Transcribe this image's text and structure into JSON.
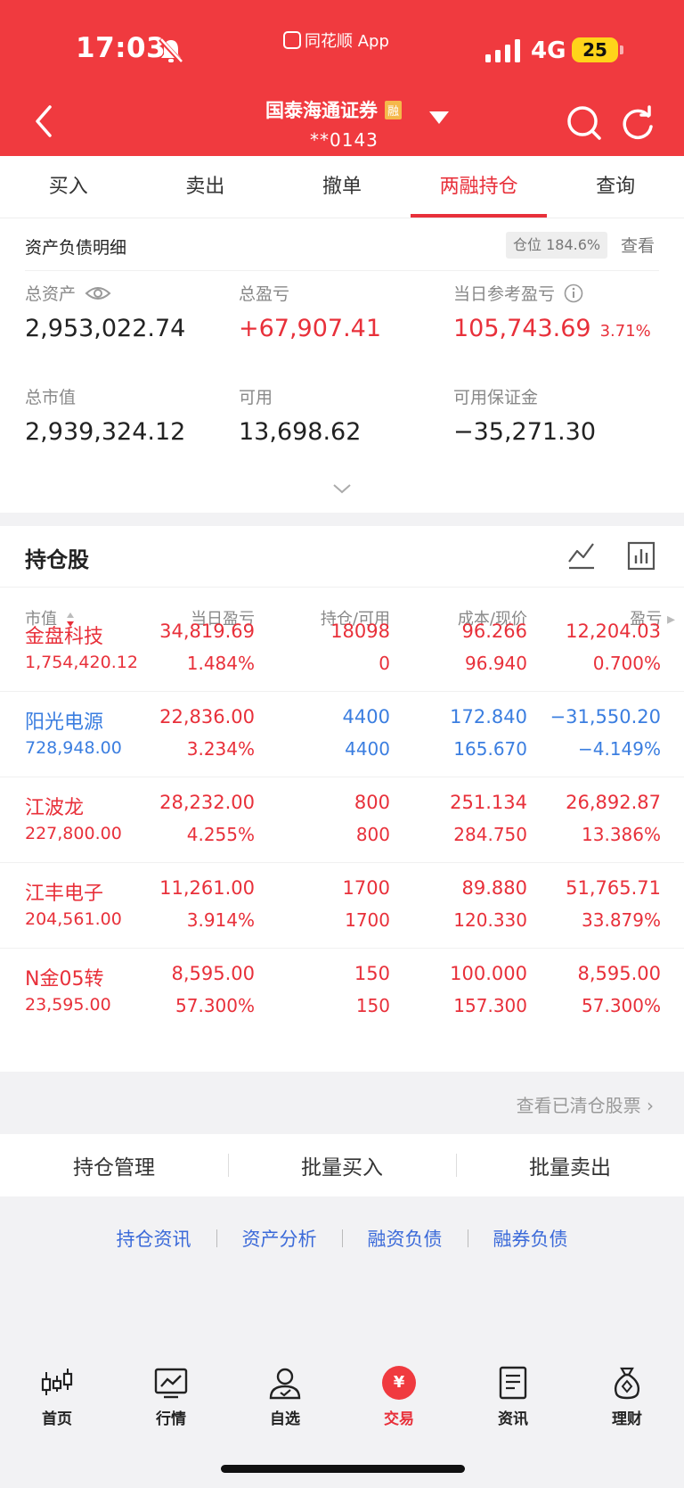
{
  "status_bar": {
    "time": "17:03",
    "app_name": "同花顺 App",
    "network": "4G",
    "battery": "25"
  },
  "header": {
    "broker": "国泰海通证券",
    "badge": "融",
    "account": "**0143"
  },
  "tabs": [
    {
      "label": "买入"
    },
    {
      "label": "卖出"
    },
    {
      "label": "撤单"
    },
    {
      "label": "两融持仓",
      "active": true
    },
    {
      "label": "查询"
    }
  ],
  "assets": {
    "title": "资产负债明细",
    "position_ratio": "仓位 184.6%",
    "view_label": "查看",
    "total_assets": {
      "label": "总资产",
      "value": "2,953,022.74"
    },
    "total_pnl": {
      "label": "总盈亏",
      "value": "+67,907.41"
    },
    "daily_pnl": {
      "label": "当日参考盈亏",
      "value": "105,743.69",
      "pct": "3.71%"
    },
    "market_value": {
      "label": "总市值",
      "value": "2,939,324.12"
    },
    "available": {
      "label": "可用",
      "value": "13,698.62"
    },
    "available_margin": {
      "label": "可用保证金",
      "value": "−35,271.30"
    }
  },
  "holdings": {
    "title": "持仓股",
    "columns": {
      "market_value": "市值",
      "daily_pnl": "当日盈亏",
      "position": "持仓/可用",
      "cost_price": "成本/现价",
      "pnl": "盈亏"
    },
    "rows": [
      {
        "name": "金盘科技",
        "market_value": "1,754,420.12",
        "daily_pnl": "34,819.69",
        "daily_pct": "1.484%",
        "position": "18098",
        "available": "0",
        "cost": "96.266",
        "price": "96.940",
        "pnl": "12,204.03",
        "pnl_pct": "0.700%",
        "color": "red"
      },
      {
        "name": "阳光电源",
        "market_value": "728,948.00",
        "daily_pnl": "22,836.00",
        "daily_pct": "3.234%",
        "position": "4400",
        "available": "4400",
        "cost": "172.840",
        "price": "165.670",
        "pnl": "−31,550.20",
        "pnl_pct": "−4.149%",
        "color": "blue"
      },
      {
        "name": "江波龙",
        "market_value": "227,800.00",
        "daily_pnl": "28,232.00",
        "daily_pct": "4.255%",
        "position": "800",
        "available": "800",
        "cost": "251.134",
        "price": "284.750",
        "pnl": "26,892.87",
        "pnl_pct": "13.386%",
        "color": "red"
      },
      {
        "name": "江丰电子",
        "market_value": "204,561.00",
        "daily_pnl": "11,261.00",
        "daily_pct": "3.914%",
        "position": "1700",
        "available": "1700",
        "cost": "89.880",
        "price": "120.330",
        "pnl": "51,765.71",
        "pnl_pct": "33.879%",
        "color": "red"
      },
      {
        "name": "N金05转",
        "market_value": "23,595.00",
        "daily_pnl": "8,595.00",
        "daily_pct": "57.300%",
        "position": "150",
        "available": "150",
        "cost": "100.000",
        "price": "157.300",
        "pnl": "8,595.00",
        "pnl_pct": "57.300%",
        "color": "red"
      }
    ],
    "cleared_link": "查看已清仓股票"
  },
  "actions": [
    "持仓管理",
    "批量买入",
    "批量卖出"
  ],
  "links": [
    "持仓资讯",
    "资产分析",
    "融资负债",
    "融券负债"
  ],
  "bottom_nav": [
    {
      "label": "首页",
      "icon": "candlestick-icon"
    },
    {
      "label": "行情",
      "icon": "chart-icon"
    },
    {
      "label": "自选",
      "icon": "person-icon"
    },
    {
      "label": "交易",
      "icon": "yen-icon",
      "active": true,
      "glyph": "¥"
    },
    {
      "label": "资讯",
      "icon": "document-icon"
    },
    {
      "label": "理财",
      "icon": "money-bag-icon"
    }
  ],
  "colors": {
    "brand_red": "#f03a3f",
    "loss_blue": "#3b7ee0",
    "link_blue": "#3b6ad9"
  }
}
